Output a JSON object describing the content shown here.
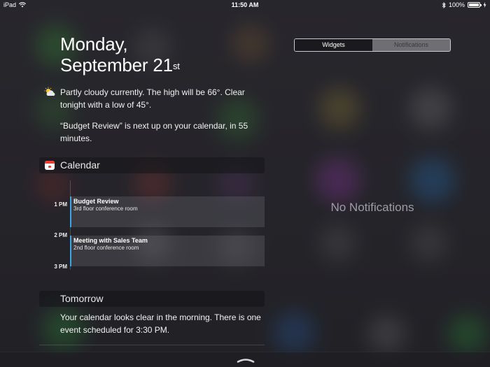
{
  "status_bar": {
    "device": "iPad",
    "time": "11:50 AM",
    "battery": "100%",
    "battery_level": 1.0
  },
  "today": {
    "day": "Monday,",
    "date_main": "September 21",
    "date_suffix": "st",
    "weather_summary": "Partly cloudy currently. The high will be 66°. Clear tonight with a low of 45°.",
    "calendar_summary": "“Budget Review” is next up on your calendar, in 55 minutes."
  },
  "calendar": {
    "title": "Calendar",
    "times": [
      "1 PM",
      "2 PM",
      "3 PM"
    ],
    "events": [
      {
        "name": "Budget Review",
        "location": "3rd floor conference room"
      },
      {
        "name": "Meeting with Sales Team",
        "location": "2nd floor conference room"
      }
    ]
  },
  "tomorrow": {
    "title": "Tomorrow",
    "summary": "Your calendar looks clear in the morning. There is one event scheduled for 3:30 PM."
  },
  "tabs": {
    "widgets": "Widgets",
    "notifications": "Notifications",
    "selected": "Widgets"
  },
  "notifications_panel": {
    "empty_text": "No Notifications"
  },
  "colors": {
    "accent_event": "#3aa6e8",
    "calendar_icon_red": "#f23b30"
  }
}
